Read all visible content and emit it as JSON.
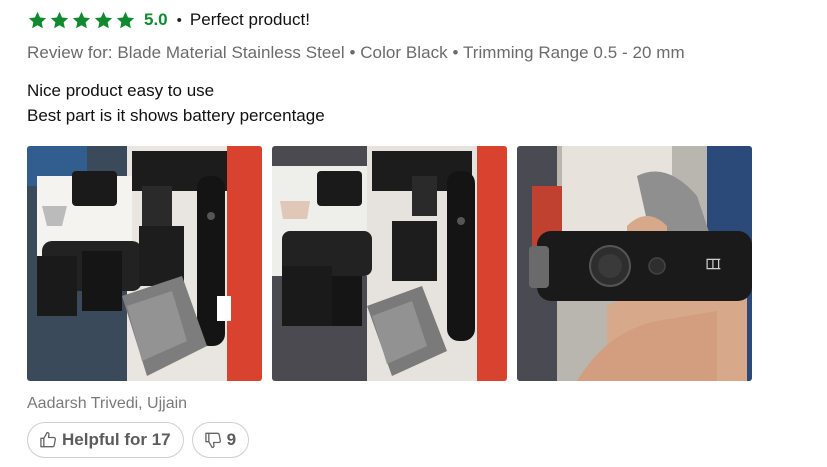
{
  "review": {
    "stars": 5,
    "rating": "5.0",
    "separator": "•",
    "title": "Perfect product!",
    "variant": "Review for: Blade Material Stainless Steel • Color Black • Trimming Range 0.5 - 20 mm",
    "body_lines": [
      "Nice product easy to use",
      "Best part is it shows battery percentage"
    ],
    "author": "Aadarsh Trivedi, Ujjain",
    "helpful_label": "Helpful for 17",
    "unhelpful_count": "9"
  },
  "colors": {
    "star": "#0f8a2f",
    "rating": "#0f8a2f",
    "muted": "#6b6b6b"
  },
  "icons": {
    "star": "star-icon",
    "thumbs_up": "thumbs-up-icon",
    "thumbs_down": "thumbs-down-icon"
  },
  "photos": [
    {
      "name": "review-photo-1",
      "subject": "trimmer kit with attachments on box"
    },
    {
      "name": "review-photo-2",
      "subject": "trimmer kit with pouch"
    },
    {
      "name": "review-photo-3",
      "subject": "trimmer held in hand"
    }
  ]
}
